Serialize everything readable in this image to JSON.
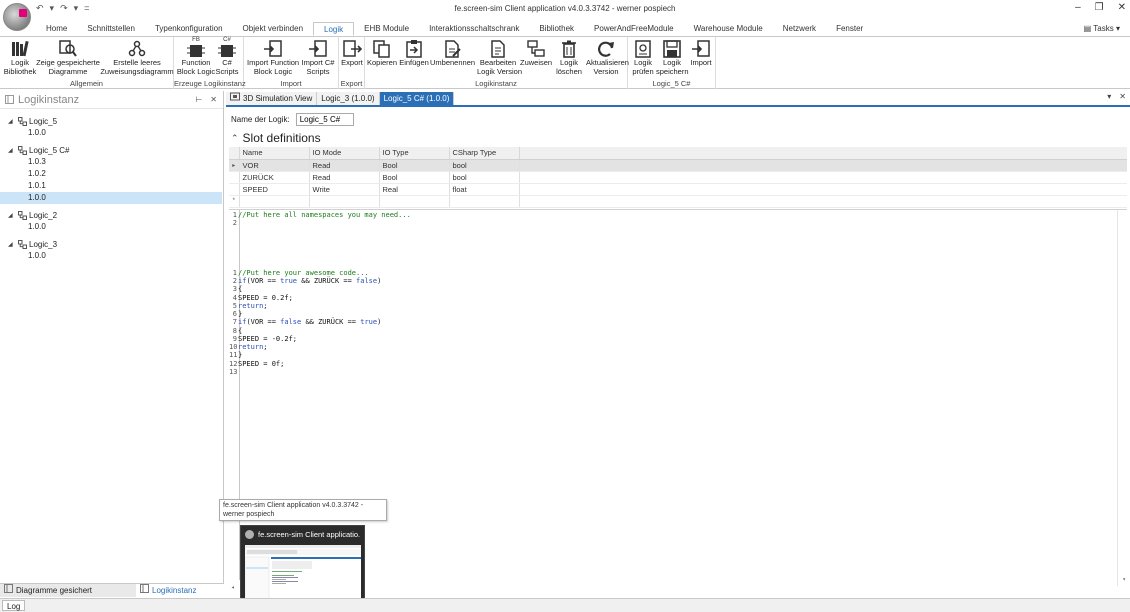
{
  "window": {
    "title": "fe.screen-sim Client application v4.0.3.3742 - werner pospiech",
    "controls": [
      "–",
      "❐",
      "✕"
    ]
  },
  "quick_access": [
    "↶",
    "▾",
    "↷",
    "▾",
    "="
  ],
  "menu": {
    "tabs": [
      {
        "label": "Home",
        "active": false
      },
      {
        "label": "Schnittstellen",
        "active": false
      },
      {
        "label": "Typenkonfiguration",
        "active": false
      },
      {
        "label": "Objekt verbinden",
        "active": false
      },
      {
        "label": "Logik",
        "active": true
      },
      {
        "label": "EHB Module",
        "active": false
      },
      {
        "label": "Interaktionsschaltschrank",
        "active": false
      },
      {
        "label": "Bibliothek",
        "active": false
      },
      {
        "label": "PowerAndFreeModule",
        "active": false
      },
      {
        "label": "Warehouse Module",
        "active": false
      },
      {
        "label": "Netzwerk",
        "active": false
      },
      {
        "label": "Fenster",
        "active": false
      }
    ],
    "tasks_label": "Tasks"
  },
  "ribbon": {
    "groups": [
      {
        "label": "Allgemein",
        "buttons": [
          {
            "line1": "Logik",
            "line2": "Bibliothek",
            "icon": "library-books-icon"
          },
          {
            "line1": "Zeige gespeicherte",
            "line2": "Diagramme",
            "icon": "search-diagram-icon"
          },
          {
            "line1": "Erstelle leeres",
            "line2": "Zuweisungsdiagramm",
            "icon": "diagram-nodes-icon"
          }
        ]
      },
      {
        "label": "Erzeuge Logikinstanz",
        "buttons": [
          {
            "line1": "Function",
            "line2": "Block Logic",
            "icon": "function-block-icon",
            "badge": "FB"
          },
          {
            "line1": "C#",
            "line2": "Scripts",
            "icon": "csharp-script-icon",
            "badge": "C#"
          }
        ]
      },
      {
        "label": "Import",
        "buttons": [
          {
            "line1": "Import Function",
            "line2": "Block Logic",
            "icon": "import-fb-icon"
          },
          {
            "line1": "Import C#",
            "line2": "Scripts",
            "icon": "import-csharp-icon"
          }
        ]
      },
      {
        "label": "Export",
        "buttons": [
          {
            "line1": "Export",
            "line2": "",
            "icon": "export-icon"
          }
        ]
      },
      {
        "label": "Logikinstanz",
        "buttons": [
          {
            "line1": "Kopieren",
            "line2": "",
            "icon": "copy-icon"
          },
          {
            "line1": "Einfügen",
            "line2": "",
            "icon": "paste-icon"
          },
          {
            "line1": "Umbenennen",
            "line2": "",
            "icon": "rename-icon"
          },
          {
            "line1": "Bearbeiten",
            "line2": "Logik Version",
            "icon": "edit-version-icon"
          },
          {
            "line1": "Zuweisen",
            "line2": "",
            "icon": "assign-icon"
          },
          {
            "line1": "Logik",
            "line2": "löschen",
            "icon": "trash-icon"
          },
          {
            "line1": "Aktualisieren",
            "line2": "Version",
            "icon": "refresh-icon"
          }
        ]
      },
      {
        "label": "Logic_5 C#",
        "buttons": [
          {
            "line1": "Logik",
            "line2": "prüfen",
            "icon": "check-logic-icon"
          },
          {
            "line1": "Logik",
            "line2": "speichern",
            "icon": "save-icon"
          },
          {
            "line1": "Import",
            "line2": "",
            "icon": "import-icon"
          }
        ]
      }
    ]
  },
  "left_panel": {
    "title": "Logikinstanz",
    "tree": [
      {
        "name": "Logic_5",
        "versions": [
          {
            "label": "1.0.0",
            "selected": false
          }
        ]
      },
      {
        "name": "Logic_5 C#",
        "versions": [
          {
            "label": "1.0.3",
            "selected": false
          },
          {
            "label": "1.0.2",
            "selected": false
          },
          {
            "label": "1.0.1",
            "selected": false
          },
          {
            "label": "1.0.0",
            "selected": true
          }
        ]
      },
      {
        "name": "Logic_2",
        "versions": [
          {
            "label": "1.0.0",
            "selected": false
          }
        ]
      },
      {
        "name": "Logic_3",
        "versions": [
          {
            "label": "1.0.0",
            "selected": false
          }
        ]
      }
    ],
    "bottom_tabs": [
      {
        "label": "Diagramme gesichert",
        "active": false
      },
      {
        "label": "Logikinstanz",
        "active": true
      }
    ]
  },
  "doc_tabs": [
    {
      "label": "3D Simulation View",
      "active": false
    },
    {
      "label": "Logic_3 (1.0.0)",
      "active": false
    },
    {
      "label": "Logic_5 C# (1.0.0)",
      "active": true
    }
  ],
  "editor": {
    "name_label": "Name der Logik:",
    "name_value": "Logic_5 C#",
    "section_title": "Slot definitions",
    "table": {
      "columns": [
        "Name",
        "IO Mode",
        "IO Type",
        "CSharp Type"
      ],
      "rows": [
        {
          "name": "VOR",
          "io_mode": "Read",
          "io_type": "Bool",
          "csharp_type": "bool"
        },
        {
          "name": "ZURÜCK",
          "io_mode": "Read",
          "io_type": "Bool",
          "csharp_type": "bool"
        },
        {
          "name": "SPEED",
          "io_mode": "Write",
          "io_type": "Real",
          "csharp_type": "float"
        }
      ],
      "new_row_marker": "*"
    },
    "code_lines": [
      {
        "n": "1",
        "text": "//Put here all namespaces you may need...",
        "kind": "cmt",
        "row": 0
      },
      {
        "n": "2",
        "text": "",
        "kind": "code",
        "row": 1
      },
      {
        "n": "1",
        "text": "//Put here your awesome code...",
        "kind": "cmt",
        "row": 7
      },
      {
        "n": "2",
        "text": "if(VOR == true && ZURÜCK == false)",
        "kind": "code",
        "row": 8
      },
      {
        "n": "3",
        "text": "{",
        "kind": "code",
        "row": 9
      },
      {
        "n": "4",
        "text": "SPEED = 0.2f;",
        "kind": "code",
        "row": 10
      },
      {
        "n": "5",
        "text": "return;",
        "kind": "code",
        "row": 11
      },
      {
        "n": "6",
        "text": "}",
        "kind": "code",
        "row": 12
      },
      {
        "n": "7",
        "text": "if(VOR == false && ZURÜCK == true)",
        "kind": "code",
        "row": 13
      },
      {
        "n": "8",
        "text": "{",
        "kind": "code",
        "row": 14
      },
      {
        "n": "9",
        "text": "SPEED = -0.2f;",
        "kind": "code",
        "row": 15
      },
      {
        "n": "10",
        "text": "return;",
        "kind": "code",
        "row": 16
      },
      {
        "n": "11",
        "text": "}",
        "kind": "code",
        "row": 17
      },
      {
        "n": "12",
        "text": "SPEED = 0f;",
        "kind": "code",
        "row": 18
      },
      {
        "n": "13",
        "text": "",
        "kind": "code",
        "row": 19
      }
    ]
  },
  "taskbar_popup": {
    "tooltip": "fe.screen-sim Client application v4.0.3.3742 - werner pospiech",
    "preview_title": "fe.screen-sim Client applicatio..."
  },
  "status": {
    "log_label": "Log"
  },
  "colors": {
    "accent": "#2b6fb6",
    "selection": "#cce4f7",
    "comment": "#1e7b1e",
    "keyword": "#2a4fb8"
  }
}
